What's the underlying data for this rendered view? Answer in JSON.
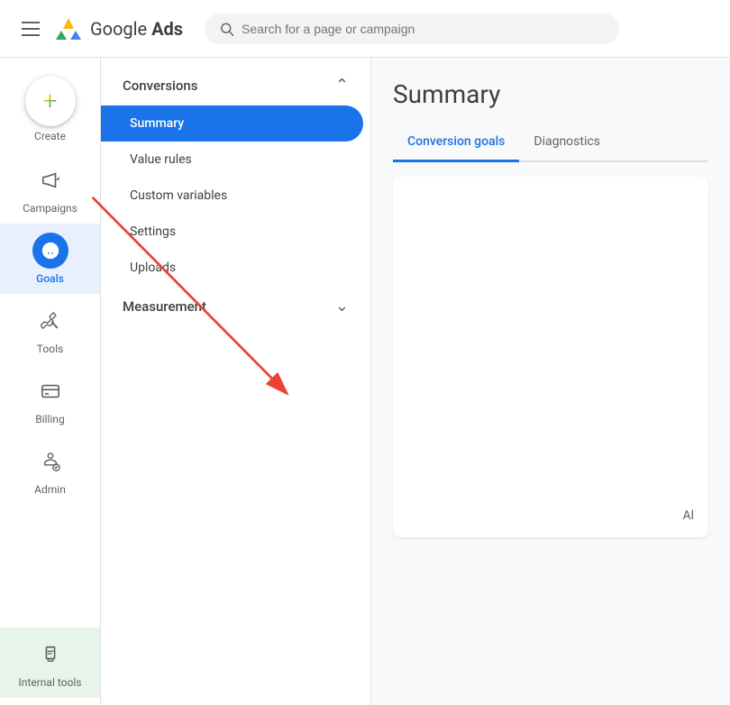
{
  "header": {
    "menu_label": "Main menu",
    "logo_text_plain": "Google ",
    "logo_text_bold": "Ads",
    "search_placeholder": "Search for a page or campaign"
  },
  "sidebar": {
    "create_label": "Create",
    "items": [
      {
        "id": "campaigns",
        "label": "Campaigns",
        "active": false
      },
      {
        "id": "goals",
        "label": "Goals",
        "active": true
      },
      {
        "id": "tools",
        "label": "Tools",
        "active": false
      },
      {
        "id": "billing",
        "label": "Billing",
        "active": false
      },
      {
        "id": "admin",
        "label": "Admin",
        "active": false
      },
      {
        "id": "internal-tools",
        "label": "Internal tools",
        "active": false,
        "special": true
      }
    ]
  },
  "sub_nav": {
    "sections": [
      {
        "id": "conversions",
        "label": "Conversions",
        "expanded": true,
        "items": [
          {
            "id": "summary",
            "label": "Summary",
            "active": true
          },
          {
            "id": "value-rules",
            "label": "Value rules",
            "active": false
          },
          {
            "id": "custom-variables",
            "label": "Custom variables",
            "active": false
          },
          {
            "id": "settings",
            "label": "Settings",
            "active": false
          },
          {
            "id": "uploads",
            "label": "Uploads",
            "active": false
          }
        ]
      },
      {
        "id": "measurement",
        "label": "Measurement",
        "expanded": false,
        "items": []
      }
    ]
  },
  "content": {
    "title": "Summary",
    "tabs": [
      {
        "id": "conversion-goals",
        "label": "Conversion goals",
        "active": true
      },
      {
        "id": "diagnostics",
        "label": "Diagnostics",
        "active": false
      }
    ],
    "panel_text": "Al"
  },
  "colors": {
    "blue": "#1a73e8",
    "red": "#ea4335",
    "yellow": "#fbbc04",
    "green": "#34a853",
    "light_green_bg": "#e6f4ea"
  }
}
